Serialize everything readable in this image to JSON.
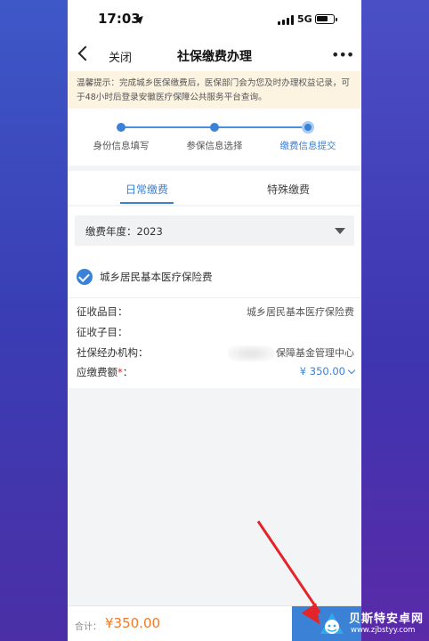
{
  "status_bar": {
    "time": "17:03",
    "network": "5G"
  },
  "nav": {
    "close_label": "关闭",
    "title": "社保缴费办理",
    "more_label": "•••"
  },
  "notice": {
    "text": "温馨提示：完成城乡医保缴费后，医保部门会为您及时办理权益记录，可于48小时后登录安徽医疗保障公共服务平台查询。"
  },
  "steps": [
    {
      "label": "身份信息填写",
      "active": false
    },
    {
      "label": "参保信息选择",
      "active": false
    },
    {
      "label": "缴费信息提交",
      "active": true
    }
  ],
  "tabs": [
    {
      "label": "日常缴费",
      "active": true
    },
    {
      "label": "特殊缴费",
      "active": false
    }
  ],
  "form": {
    "year_label": "缴费年度：2023",
    "insurance_name": "城乡居民基本医疗保险费",
    "rows": [
      {
        "label": "征收品目：",
        "value": "城乡居民基本医疗保险费"
      },
      {
        "label": "征收子目：",
        "value": ""
      },
      {
        "label": "社保经办机构：",
        "value": "保障基金管理中心"
      },
      {
        "label": "应缴费额",
        "required_mark": "*",
        "colon": "：",
        "value": "¥ 350.00"
      }
    ]
  },
  "footer": {
    "total_label": "合计：",
    "total_value": "¥350.00"
  },
  "watermark": {
    "title": "贝斯特安卓网",
    "url": "www.zjbstyy.com"
  },
  "colors": {
    "accent": "#3b82d6",
    "notice_bg": "#fdf3e1",
    "total": "#f07a2a",
    "arrow": "#e3252a"
  }
}
